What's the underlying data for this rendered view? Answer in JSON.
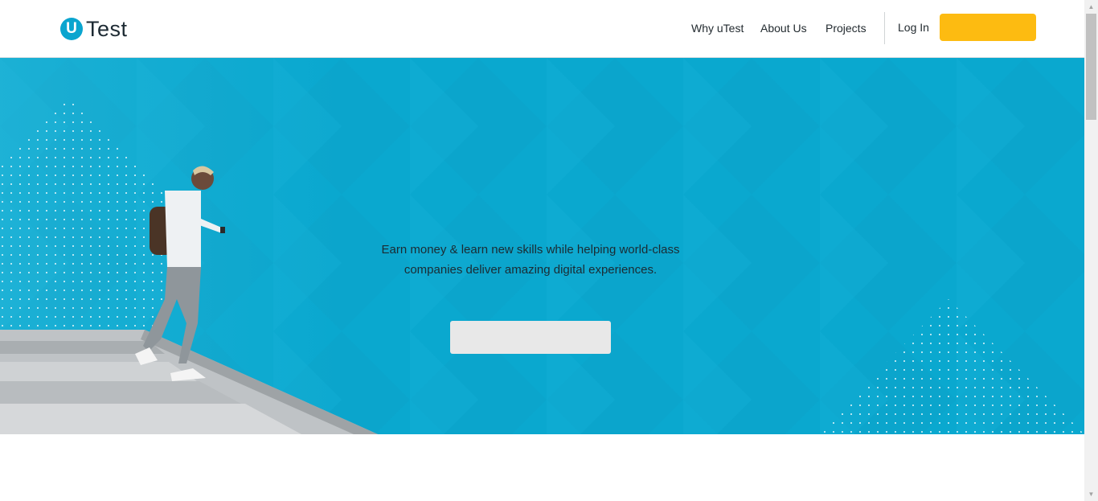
{
  "header": {
    "logo_mark": "U",
    "logo_text": "Test",
    "nav": [
      {
        "label": "Why uTest"
      },
      {
        "label": "About Us"
      },
      {
        "label": "Projects"
      }
    ],
    "login_label": "Log In",
    "cta_label": ""
  },
  "hero": {
    "tagline_line1": "Earn money & learn new skills while helping world-class",
    "tagline_line2": "companies deliver amazing digital experiences.",
    "button_label": ""
  },
  "colors": {
    "brand": "#0aa5cf",
    "hero_bg": "#0aa8cf",
    "cta": "#fdbb11",
    "hero_button": "#e8e8e8"
  },
  "icons": {
    "scroll_up": "scroll-up-arrow-icon",
    "scroll_down": "scroll-down-arrow-icon"
  }
}
